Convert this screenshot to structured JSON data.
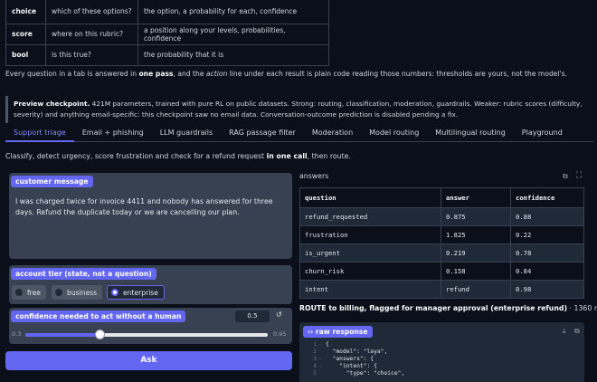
{
  "top_table": [
    {
      "key": "choice",
      "question": "which of these options?",
      "desc": "the option, a probability for each, confidence"
    },
    {
      "key": "score",
      "question": "where on this rubric?",
      "desc": "a position along your levels, probabilities, confidence"
    },
    {
      "key": "bool",
      "question": "is this true?",
      "desc": "the probability that it is"
    }
  ],
  "para": {
    "p1": "Every question in a tab is answered in ",
    "b1": "one pass",
    "p2": ", and the ",
    "i1": "action",
    "p3": " line under each result is plain code reading those numbers: thresholds are yours, not the model's."
  },
  "notice": {
    "bold": "Preview checkpoint.",
    "text": " 421M parameters, trained with pure RL on public datasets. Strong: routing, classification, moderation, guardrails. Weaker: rubric scores (difficulty, severity) and anything email-specific: this checkpoint saw no email data. Conversation-outcome prediction is disabled pending a fix."
  },
  "tabs": [
    "Support triage",
    "Email + phishing",
    "LLM guardrails",
    "RAG passage filter",
    "Moderation",
    "Model routing",
    "Multilingual routing",
    "Playground"
  ],
  "instructions": {
    "p1": "Classify, detect urgency, score frustration and check for a refund request ",
    "b1": "in one call",
    "p2": ", then route."
  },
  "customer_message": {
    "label": "customer message",
    "value": "I was charged twice for invoice 4411 and nobody has answered for three days. Refund the duplicate today or we are cancelling our plan."
  },
  "account_tier": {
    "label": "account tier (state, not a question)",
    "options": [
      "free",
      "business",
      "enterprise"
    ],
    "selected": "enterprise"
  },
  "confidence": {
    "label": "confidence needed to act without a human",
    "value": "0.5",
    "min": "0.3",
    "max": "0.95",
    "level": 0.5
  },
  "ask_label": "Ask",
  "answers": {
    "label": "answers",
    "headers": [
      "question",
      "answer",
      "confidence"
    ],
    "rows": [
      [
        "refund_requested",
        "0.875",
        "0.88"
      ],
      [
        "frustration",
        "1.825",
        "0.22"
      ],
      [
        "is_urgent",
        "0.219",
        "0.78"
      ],
      [
        "churn_risk",
        "0.158",
        "0.84"
      ],
      [
        "intent",
        "refund",
        "0.98"
      ]
    ]
  },
  "route": {
    "bold": "ROUTE to billing, flagged for manager approval (enterprise refund)",
    "time": " · 1360 ms"
  },
  "raw": {
    "label": "raw response",
    "lines": [
      {
        "n": "1",
        "fold": "-",
        "text": "{"
      },
      {
        "n": "2",
        "fold": "",
        "text": "  \"model\": \"laya\","
      },
      {
        "n": "3",
        "fold": "-",
        "text": "  \"answers\": {"
      },
      {
        "n": "4",
        "fold": "-",
        "text": "    \"intent\": {"
      },
      {
        "n": "5",
        "fold": "",
        "text": "      \"type\": \"choice\","
      }
    ]
  },
  "colors": {
    "accent": "#6366f1",
    "background": "#0b0f19",
    "panel": "#374151"
  },
  "icons": [
    "copy-icon",
    "expand-icon",
    "reset-icon",
    "download-icon",
    "code-icon"
  ]
}
